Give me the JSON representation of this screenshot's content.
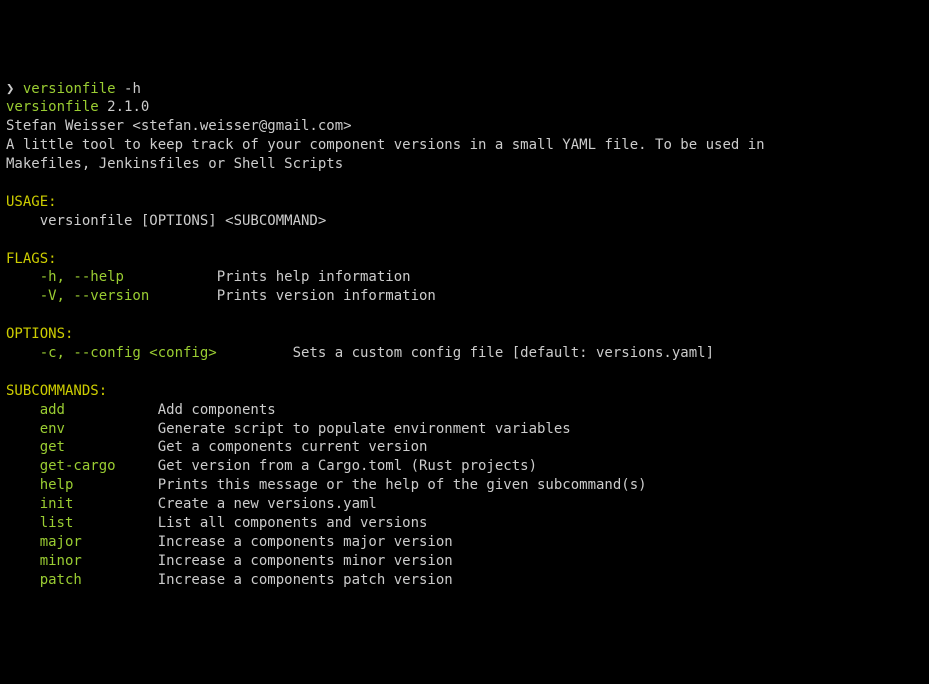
{
  "prompt": {
    "symbol": "❯",
    "command": "versionfile",
    "arg": "-h"
  },
  "header": {
    "program": "versionfile",
    "version": "2.1.0",
    "author": "Stefan Weisser <stefan.weisser@gmail.com>",
    "description_line1": "A little tool to keep track of your component versions in a small YAML file. To be used in",
    "description_line2": "Makefiles, Jenkinsfiles or Shell Scripts"
  },
  "usage": {
    "heading": "USAGE:",
    "text": "versionfile [OPTIONS] <SUBCOMMAND>"
  },
  "flags": {
    "heading": "FLAGS:",
    "items": [
      {
        "flag": "-h, --help",
        "desc": "Prints help information"
      },
      {
        "flag": "-V, --version",
        "desc": "Prints version information"
      }
    ]
  },
  "options": {
    "heading": "OPTIONS:",
    "items": [
      {
        "opt": "-c, --config <config>",
        "desc": "Sets a custom config file [default: versions.yaml]"
      }
    ]
  },
  "subcommands": {
    "heading": "SUBCOMMANDS:",
    "items": [
      {
        "name": "add",
        "desc": "Add components"
      },
      {
        "name": "env",
        "desc": "Generate script to populate environment variables"
      },
      {
        "name": "get",
        "desc": "Get a components current version"
      },
      {
        "name": "get-cargo",
        "desc": "Get version from a Cargo.toml (Rust projects)"
      },
      {
        "name": "help",
        "desc": "Prints this message or the help of the given subcommand(s)"
      },
      {
        "name": "init",
        "desc": "Create a new versions.yaml"
      },
      {
        "name": "list",
        "desc": "List all components and versions"
      },
      {
        "name": "major",
        "desc": "Increase a components major version"
      },
      {
        "name": "minor",
        "desc": "Increase a components minor version"
      },
      {
        "name": "patch",
        "desc": "Increase a components patch version"
      }
    ]
  }
}
